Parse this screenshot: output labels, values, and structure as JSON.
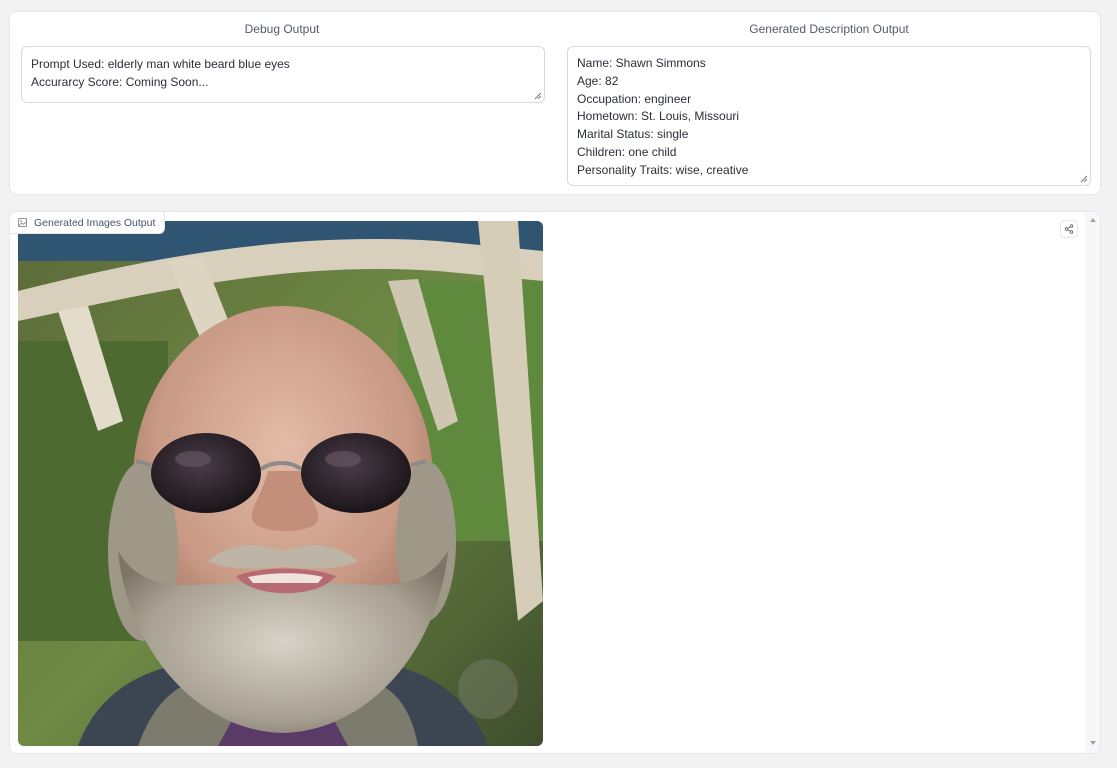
{
  "debug": {
    "label": "Debug Output",
    "lines": [
      "Prompt Used: elderly man white beard blue eyes",
      "Accurarcy Score: Coming Soon..."
    ]
  },
  "description": {
    "label": "Generated Description Output",
    "lines": [
      "Name: Shawn Simmons",
      "Age: 82",
      "Occupation: engineer",
      "Hometown: St. Louis, Missouri",
      "Marital Status: single",
      "Children: one child",
      "Personality Traits: wise, creative"
    ]
  },
  "images": {
    "label": "Generated Images Output",
    "icon": "image-icon",
    "share_icon": "share-icon"
  },
  "colors": {
    "page_bg": "#f2f2f2",
    "panel_bg": "#ffffff",
    "border": "#e5e7eb",
    "text": "#2b2f36"
  }
}
